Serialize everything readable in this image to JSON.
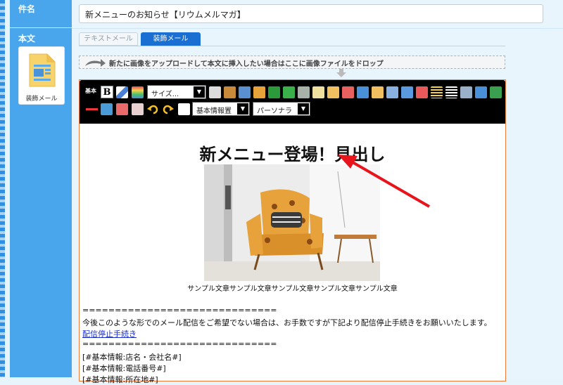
{
  "form": {
    "subject_label": "件名",
    "body_label": "本文",
    "subject_value": "新メニューのお知らせ【リウムメルマガ】"
  },
  "sidebar": {
    "deco_card_label": "装飾メール"
  },
  "tabs": [
    {
      "label": "テキストメール"
    },
    {
      "label": "装飾メール"
    }
  ],
  "dropzone": {
    "text": "新たに画像をアップロードして本文に挿入したい場合はここに画像ファイルをドロップ"
  },
  "toolbar": {
    "base_label": "基本",
    "bold_label": "B",
    "size_select": "サイズ...",
    "info_select": "基本情報置",
    "personalize_select": "パーソナラ",
    "dropdown_glyph": "▼"
  },
  "email": {
    "headline": "新メニュー登場！見出し",
    "caption": "サンプル文章サンプル文章サンプル文章サンプル文章サンプル文章",
    "divider": "==============================",
    "unsubscribe_notice": "今後このような形でのメール配信をご希望でない場合は、お手数ですが下記より配信停止手続きをお願いいたします。",
    "unsubscribe_link": "配信停止手続き",
    "divider2": "==============================",
    "placeholder1": "[#基本情報:店名・会社名#]",
    "placeholder2": "[#基本情報:電話番号#]",
    "placeholder3": "[#基本情報:所在地#]"
  },
  "colors": {
    "sidebar": "#4aa6ec",
    "active_tab": "#1a6fd2",
    "editor_border": "#ef7a3a",
    "annotation_arrow": "#e8141b",
    "link": "#1a2fd0"
  }
}
